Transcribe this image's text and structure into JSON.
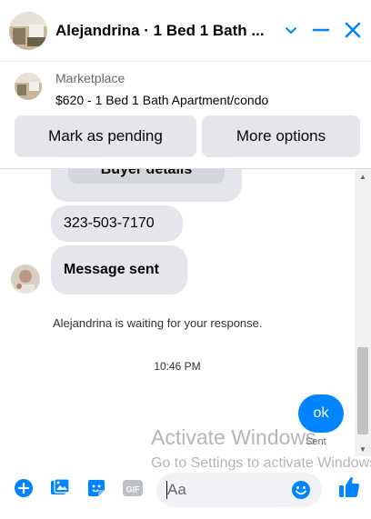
{
  "header": {
    "title": "Alejandrina · 1 Bed 1 Bath ...",
    "icons": [
      "profile-photo",
      "chevron-down-icon",
      "minimize-icon",
      "close-icon"
    ]
  },
  "marketplace": {
    "label": "Marketplace",
    "listing": "$620 - 1 Bed 1 Bath Apartment/condo",
    "mark_pending_label": "Mark as pending",
    "more_options_label": "More options"
  },
  "messages": {
    "card_title": "Buyer details",
    "phone": "323-503-7170",
    "message_sent": "Message sent",
    "waiting_status": "Alejandrina is waiting for your response.",
    "timestamp": "10:46 PM",
    "outgoing_text": "ok",
    "sent_label": "Sent"
  },
  "watermark": {
    "line1": "Activate Windows",
    "line2": "Go to Settings to activate Windows."
  },
  "composer": {
    "placeholder": "Aa",
    "icons": [
      "plus-icon",
      "photo-icon",
      "sticker-icon",
      "gif-icon",
      "emoji-icon",
      "like-thumb-icon"
    ]
  },
  "colors": {
    "accent": "#0084ff",
    "bubble_gray": "#e4e6eb",
    "button_gray": "#e4e6eb"
  }
}
